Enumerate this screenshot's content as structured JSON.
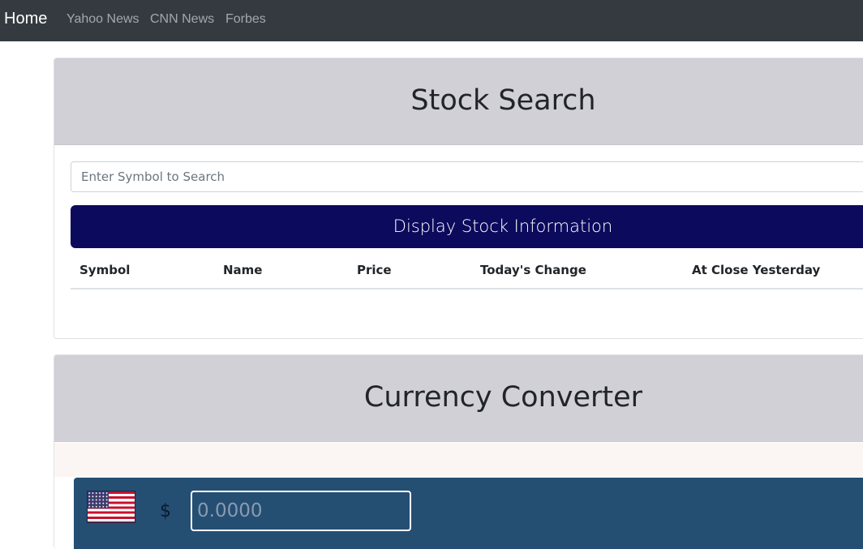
{
  "nav": {
    "brand": "Home",
    "links": [
      "Yahoo News",
      "CNN News",
      "Forbes"
    ]
  },
  "stock_search": {
    "title": "Stock Search",
    "search_placeholder": "Enter Symbol to Search",
    "button_label": "Display Stock Information",
    "table_headers": [
      "Symbol",
      "Name",
      "Price",
      "Today's Change",
      "At Close Yesterday"
    ]
  },
  "currency_converter": {
    "title": "Currency Converter",
    "flag_icon": "us-flag-icon",
    "currency_symbol": "$",
    "amount_placeholder": "0.0000"
  },
  "colors": {
    "navbar": "#343a40",
    "card_header": "#d1d0d6",
    "display_button": "#0b0a5c",
    "converter_row": "#254e73"
  }
}
